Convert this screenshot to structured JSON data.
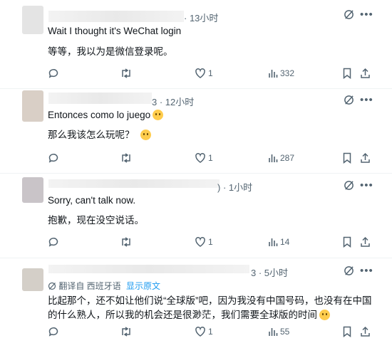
{
  "tweets": [
    {
      "time": "· 13小时",
      "lines": [
        "Wait I thought it's WeChat login",
        "等等，我以为是微信登录呢。"
      ],
      "likes": "1",
      "views": "332"
    },
    {
      "time": "3 · 12小时",
      "lines": [
        "Entonces como lo juego",
        "那么我该怎么玩呢？"
      ],
      "likes": "1",
      "views": "287"
    },
    {
      "time": ") · 1小时",
      "lines": [
        "Sorry, can't talk now.",
        "抱歉，现在没空说话。"
      ],
      "likes": "1",
      "views": "14"
    },
    {
      "time": "3 · 5小时",
      "translation_note": "翻译自 西班牙语",
      "translation_link": "显示原文",
      "lines": [
        "比起那个，还不如让他们说“全球版”吧，因为我没有中国号码，也没有在中国",
        "的什么熟人，所以我的机会还是很渺茫，我们需要全球版的时间"
      ],
      "likes": "1",
      "views": "55"
    }
  ],
  "icons": {
    "reply": "reply-icon",
    "retweet": "retweet-icon",
    "like": "heart-icon",
    "views": "views-chart-icon",
    "bookmark": "bookmark-icon",
    "share": "share-icon",
    "grok": "grok-icon",
    "more": "more-icon"
  },
  "colors": {
    "text": "#0f1419",
    "muted": "#536471",
    "link": "#1d9bf0",
    "divider": "#eff3f4"
  }
}
